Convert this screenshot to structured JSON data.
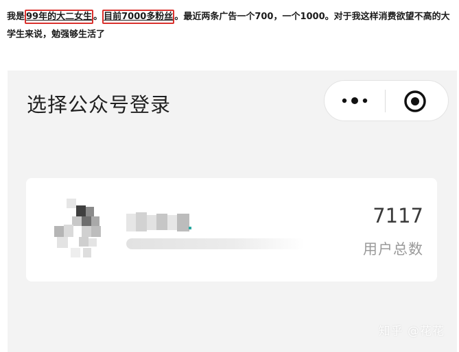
{
  "caption": {
    "part1": "我是",
    "highlight1": "99年的大二女生",
    "part2": "。",
    "highlight2": "目前7000多粉丝",
    "part3": "。最近两条广告一个700，一个1000。对于我这样消费欲望不高的大学生来说，勉强够生活了",
    "highlight_color": "#d9302c"
  },
  "miniapp": {
    "title": "选择公众号登录",
    "capsule": {
      "more_icon": "more-dots-icon",
      "close_icon": "target-close-icon"
    },
    "account_card": {
      "avatar_icon": "blurred-avatar-icon",
      "user_count": "7117",
      "user_count_label": "用户总数"
    },
    "background_color": "#f3f3f3"
  },
  "watermark": "知乎 @花花"
}
